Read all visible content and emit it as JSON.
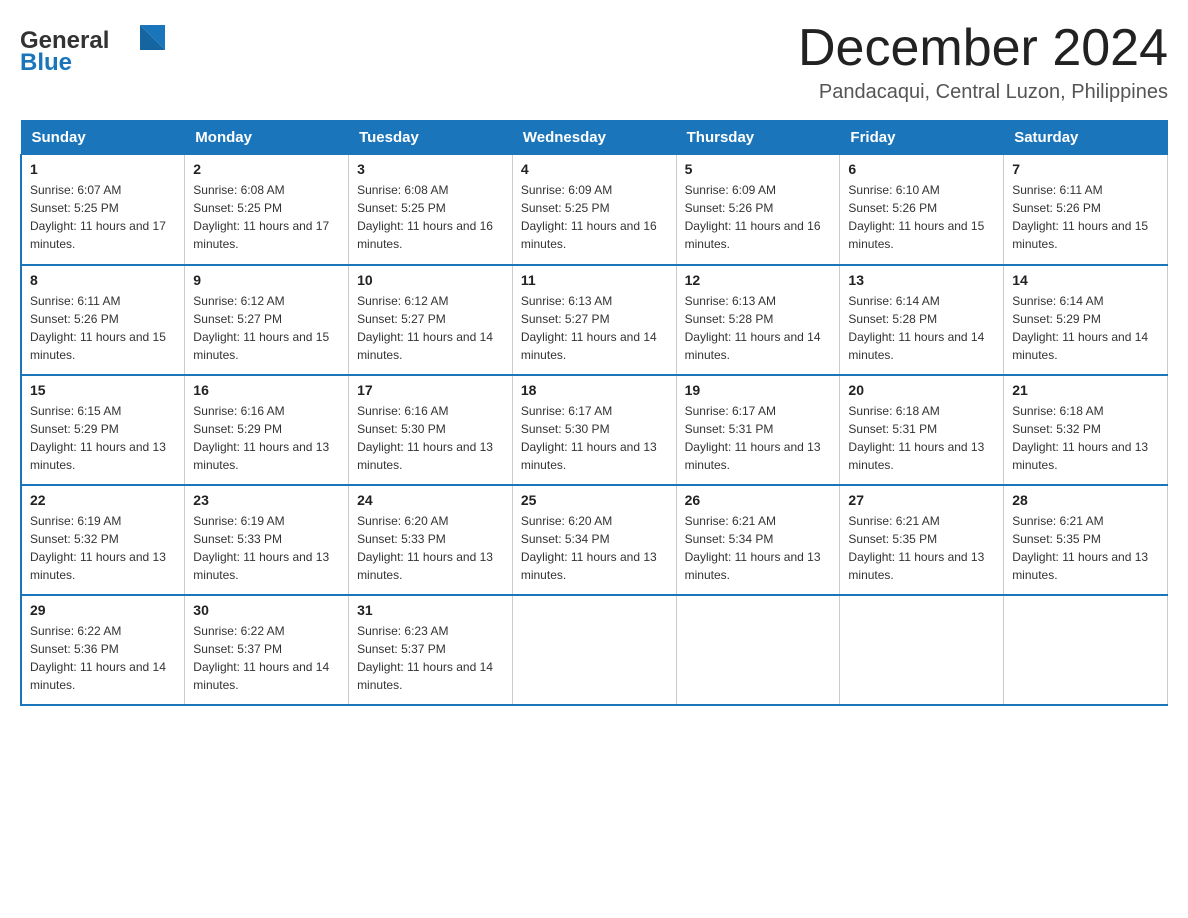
{
  "logo": {
    "line1": "General",
    "line2": "Blue"
  },
  "title": "December 2024",
  "subtitle": "Pandacaqui, Central Luzon, Philippines",
  "days_header": [
    "Sunday",
    "Monday",
    "Tuesday",
    "Wednesday",
    "Thursday",
    "Friday",
    "Saturday"
  ],
  "weeks": [
    [
      {
        "day": "1",
        "sunrise": "6:07 AM",
        "sunset": "5:25 PM",
        "daylight": "11 hours and 17 minutes."
      },
      {
        "day": "2",
        "sunrise": "6:08 AM",
        "sunset": "5:25 PM",
        "daylight": "11 hours and 17 minutes."
      },
      {
        "day": "3",
        "sunrise": "6:08 AM",
        "sunset": "5:25 PM",
        "daylight": "11 hours and 16 minutes."
      },
      {
        "day": "4",
        "sunrise": "6:09 AM",
        "sunset": "5:25 PM",
        "daylight": "11 hours and 16 minutes."
      },
      {
        "day": "5",
        "sunrise": "6:09 AM",
        "sunset": "5:26 PM",
        "daylight": "11 hours and 16 minutes."
      },
      {
        "day": "6",
        "sunrise": "6:10 AM",
        "sunset": "5:26 PM",
        "daylight": "11 hours and 15 minutes."
      },
      {
        "day": "7",
        "sunrise": "6:11 AM",
        "sunset": "5:26 PM",
        "daylight": "11 hours and 15 minutes."
      }
    ],
    [
      {
        "day": "8",
        "sunrise": "6:11 AM",
        "sunset": "5:26 PM",
        "daylight": "11 hours and 15 minutes."
      },
      {
        "day": "9",
        "sunrise": "6:12 AM",
        "sunset": "5:27 PM",
        "daylight": "11 hours and 15 minutes."
      },
      {
        "day": "10",
        "sunrise": "6:12 AM",
        "sunset": "5:27 PM",
        "daylight": "11 hours and 14 minutes."
      },
      {
        "day": "11",
        "sunrise": "6:13 AM",
        "sunset": "5:27 PM",
        "daylight": "11 hours and 14 minutes."
      },
      {
        "day": "12",
        "sunrise": "6:13 AM",
        "sunset": "5:28 PM",
        "daylight": "11 hours and 14 minutes."
      },
      {
        "day": "13",
        "sunrise": "6:14 AM",
        "sunset": "5:28 PM",
        "daylight": "11 hours and 14 minutes."
      },
      {
        "day": "14",
        "sunrise": "6:14 AM",
        "sunset": "5:29 PM",
        "daylight": "11 hours and 14 minutes."
      }
    ],
    [
      {
        "day": "15",
        "sunrise": "6:15 AM",
        "sunset": "5:29 PM",
        "daylight": "11 hours and 13 minutes."
      },
      {
        "day": "16",
        "sunrise": "6:16 AM",
        "sunset": "5:29 PM",
        "daylight": "11 hours and 13 minutes."
      },
      {
        "day": "17",
        "sunrise": "6:16 AM",
        "sunset": "5:30 PM",
        "daylight": "11 hours and 13 minutes."
      },
      {
        "day": "18",
        "sunrise": "6:17 AM",
        "sunset": "5:30 PM",
        "daylight": "11 hours and 13 minutes."
      },
      {
        "day": "19",
        "sunrise": "6:17 AM",
        "sunset": "5:31 PM",
        "daylight": "11 hours and 13 minutes."
      },
      {
        "day": "20",
        "sunrise": "6:18 AM",
        "sunset": "5:31 PM",
        "daylight": "11 hours and 13 minutes."
      },
      {
        "day": "21",
        "sunrise": "6:18 AM",
        "sunset": "5:32 PM",
        "daylight": "11 hours and 13 minutes."
      }
    ],
    [
      {
        "day": "22",
        "sunrise": "6:19 AM",
        "sunset": "5:32 PM",
        "daylight": "11 hours and 13 minutes."
      },
      {
        "day": "23",
        "sunrise": "6:19 AM",
        "sunset": "5:33 PM",
        "daylight": "11 hours and 13 minutes."
      },
      {
        "day": "24",
        "sunrise": "6:20 AM",
        "sunset": "5:33 PM",
        "daylight": "11 hours and 13 minutes."
      },
      {
        "day": "25",
        "sunrise": "6:20 AM",
        "sunset": "5:34 PM",
        "daylight": "11 hours and 13 minutes."
      },
      {
        "day": "26",
        "sunrise": "6:21 AM",
        "sunset": "5:34 PM",
        "daylight": "11 hours and 13 minutes."
      },
      {
        "day": "27",
        "sunrise": "6:21 AM",
        "sunset": "5:35 PM",
        "daylight": "11 hours and 13 minutes."
      },
      {
        "day": "28",
        "sunrise": "6:21 AM",
        "sunset": "5:35 PM",
        "daylight": "11 hours and 13 minutes."
      }
    ],
    [
      {
        "day": "29",
        "sunrise": "6:22 AM",
        "sunset": "5:36 PM",
        "daylight": "11 hours and 14 minutes."
      },
      {
        "day": "30",
        "sunrise": "6:22 AM",
        "sunset": "5:37 PM",
        "daylight": "11 hours and 14 minutes."
      },
      {
        "day": "31",
        "sunrise": "6:23 AM",
        "sunset": "5:37 PM",
        "daylight": "11 hours and 14 minutes."
      },
      null,
      null,
      null,
      null
    ]
  ],
  "labels": {
    "sunrise": "Sunrise:",
    "sunset": "Sunset:",
    "daylight": "Daylight:"
  },
  "accent_color": "#1a75bb"
}
